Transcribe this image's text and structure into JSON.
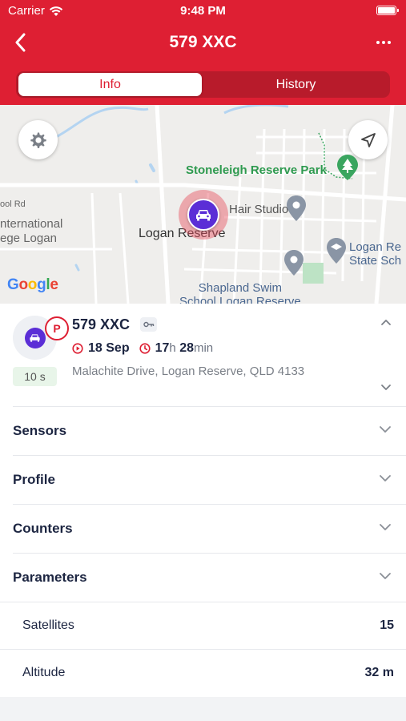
{
  "status_bar": {
    "carrier": "Carrier",
    "time": "9:48 PM"
  },
  "nav": {
    "title": "579 XXC"
  },
  "tabs": [
    {
      "label": "Info",
      "active": true
    },
    {
      "label": "History",
      "active": false
    }
  ],
  "map": {
    "labels": {
      "park": "Stoneleigh Reserve Park",
      "hair_studio": "Hair Studio",
      "suburb": "Logan Reserve",
      "school_line1": "Logan Re",
      "school_line2": "State Sch",
      "swim_line1": "Shapland Swim",
      "swim_line2": "School Logan Reserve",
      "intl_line1": "nternational",
      "intl_line2": "ege Logan",
      "pool_rd": "ool Rd"
    },
    "google": [
      "G",
      "o",
      "o",
      "g",
      "l",
      "e"
    ]
  },
  "vehicle": {
    "name": "579 XXC",
    "parking_badge": "P",
    "interval": "10 s",
    "date": "18 Sep",
    "duration_hours": "17",
    "duration_hours_unit": "h",
    "duration_minutes": "28",
    "duration_minutes_unit": "min",
    "address": "Malachite Drive, Logan Reserve, QLD 4133"
  },
  "sections": [
    {
      "label": "Sensors"
    },
    {
      "label": "Profile"
    },
    {
      "label": "Counters"
    },
    {
      "label": "Parameters"
    }
  ],
  "parameters": [
    {
      "label": "Satellites",
      "value": "15"
    },
    {
      "label": "Altitude",
      "value": "32 m"
    }
  ],
  "colors": {
    "brand_red": "#de1f33",
    "vehicle_purple": "#5b2ed6",
    "park_green": "#2e9a4f",
    "text_dark": "#1c2541"
  },
  "icons": [
    "wifi-icon",
    "battery-icon",
    "back-arrow-icon",
    "more-icon",
    "gear-icon",
    "locate-arrow-icon",
    "car-icon",
    "key-icon",
    "play-circle-icon",
    "clock-icon",
    "chevron-up-icon",
    "chevron-down-icon",
    "tree-icon",
    "map-pin-icon"
  ]
}
